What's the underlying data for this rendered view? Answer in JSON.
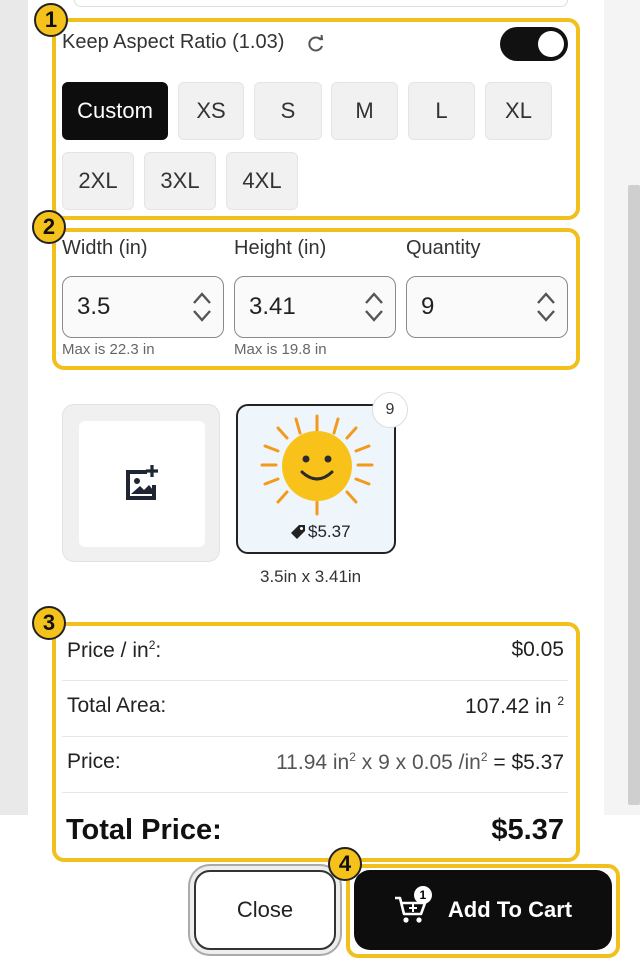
{
  "aspect": {
    "label": "Keep Aspect Ratio (1.03)",
    "enabled": true
  },
  "sizes": [
    {
      "label": "Custom",
      "active": true
    },
    {
      "label": "XS"
    },
    {
      "label": "S"
    },
    {
      "label": "M"
    },
    {
      "label": "L"
    },
    {
      "label": "XL"
    },
    {
      "label": "2XL"
    },
    {
      "label": "3XL"
    },
    {
      "label": "4XL"
    }
  ],
  "dimensions": {
    "width_label": "Width (in)",
    "width_value": "3.5",
    "width_max": "Max is 22.3 in",
    "height_label": "Height (in)",
    "height_value": "3.41",
    "height_max": "Max is 19.8 in",
    "quantity_label": "Quantity",
    "quantity_value": "9"
  },
  "preview": {
    "count": "9",
    "price": "$5.37",
    "dims": "3.5in x 3.41in"
  },
  "pricing": {
    "per_area_label": "Price / in",
    "per_area_exp": "2",
    "per_area_suffix": ":",
    "per_area_value": "$0.05",
    "area_label": "Total Area:",
    "area_value": "107.42 in",
    "area_exp": "2",
    "price_label": "Price:",
    "price_part1": "11.94 in",
    "price_exp1": "2",
    "price_part2": " x 9 x 0.05 /in",
    "price_exp2": "2",
    "price_part3": " = $5.37",
    "total_label": "Total Price:",
    "total_value": "$5.37"
  },
  "buttons": {
    "close": "Close",
    "add_to_cart": "Add To Cart",
    "cart_count": "1"
  },
  "badges": [
    "1",
    "2",
    "3",
    "4"
  ],
  "colors": {
    "highlight": "#f2c01c",
    "primary": "#0d0d0d"
  }
}
